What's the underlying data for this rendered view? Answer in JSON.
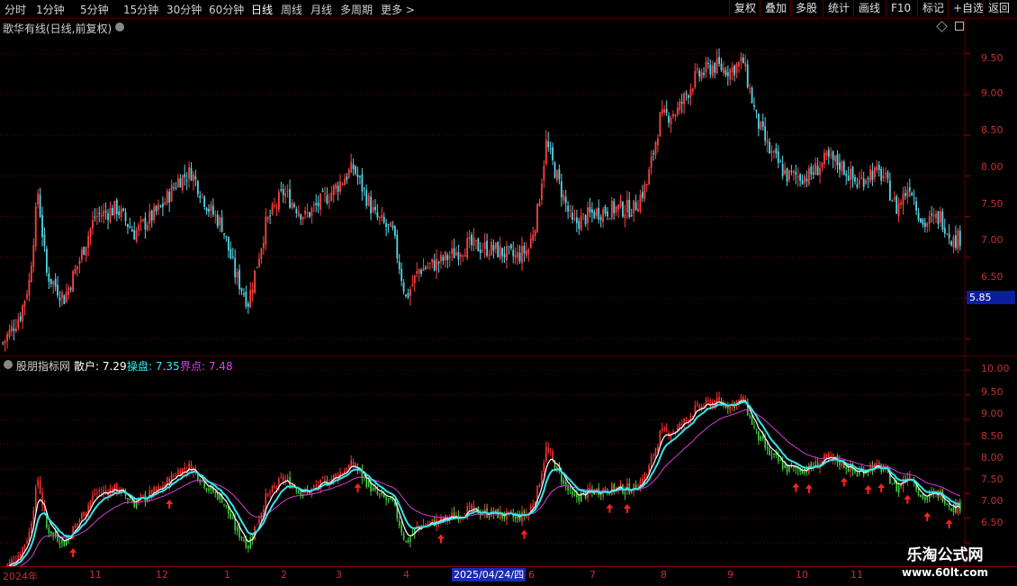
{
  "toolbar": {
    "periods": [
      "分时",
      "1分钟",
      "5分钟",
      "15分钟",
      "30分钟",
      "60分钟",
      "日线",
      "周线",
      "月线",
      "多周期",
      "更多"
    ],
    "active_period": "日线",
    "more_arrow": ">",
    "right_buttons": [
      "复权",
      "叠加",
      "多股",
      "统计",
      "画线",
      "F10",
      "标记",
      "+自选",
      "返回"
    ]
  },
  "main_panel": {
    "title": "歌华有线(日线,前复权)",
    "y_axis": [
      "9.50",
      "9.00",
      "8.50",
      "8.00",
      "7.50",
      "7.00",
      "6.50"
    ],
    "price_tag": "5.85"
  },
  "indicator_panel": {
    "title": "股朋指标网",
    "series": [
      {
        "label": "散户: 7.29",
        "color": "#ffffff"
      },
      {
        "label": "操盘: 7.35",
        "color": "#33e6f0"
      },
      {
        "label": "界点: 7.48",
        "color": "#e040e0"
      }
    ],
    "y_axis": [
      "10.00",
      "9.50",
      "9.00",
      "8.50",
      "8.00",
      "7.50",
      "7.00",
      "6.50"
    ]
  },
  "date_axis": {
    "labels": [
      "2024年",
      "11",
      "12",
      "1",
      "2",
      "3",
      "4",
      "6",
      "7",
      "8",
      "9",
      "10",
      "11"
    ],
    "cursor_label": "2025/04/24/四"
  },
  "watermark": {
    "line1": "乐淘公式网",
    "line2": "www.60lt.com"
  },
  "colors": {
    "up": "#ff4040",
    "down": "#54d6e6",
    "ind_up": "#ff3030",
    "ind_down": "#40d040",
    "signal": "#ff2020",
    "grid": "#5a0000"
  },
  "chart_data": {
    "type": "candlestick",
    "title": "歌华有线(日线,前复权)",
    "ylim": [
      5.85,
      9.85
    ],
    "series": [
      {
        "name": "close_approx",
        "x": [
          "2024-10",
          "2024-11",
          "2024-12",
          "2025-01",
          "2025-02",
          "2025-03",
          "2025-04",
          "2025-05",
          "2025-06",
          "2025-07",
          "2025-08",
          "2025-09",
          "2025-10",
          "2025-11"
        ],
        "values": [
          6.4,
          7.4,
          7.8,
          6.8,
          7.7,
          7.7,
          6.9,
          7.1,
          7.6,
          7.6,
          9.1,
          8.0,
          8.0,
          7.2
        ]
      }
    ],
    "signal_arrows_count": 17
  }
}
